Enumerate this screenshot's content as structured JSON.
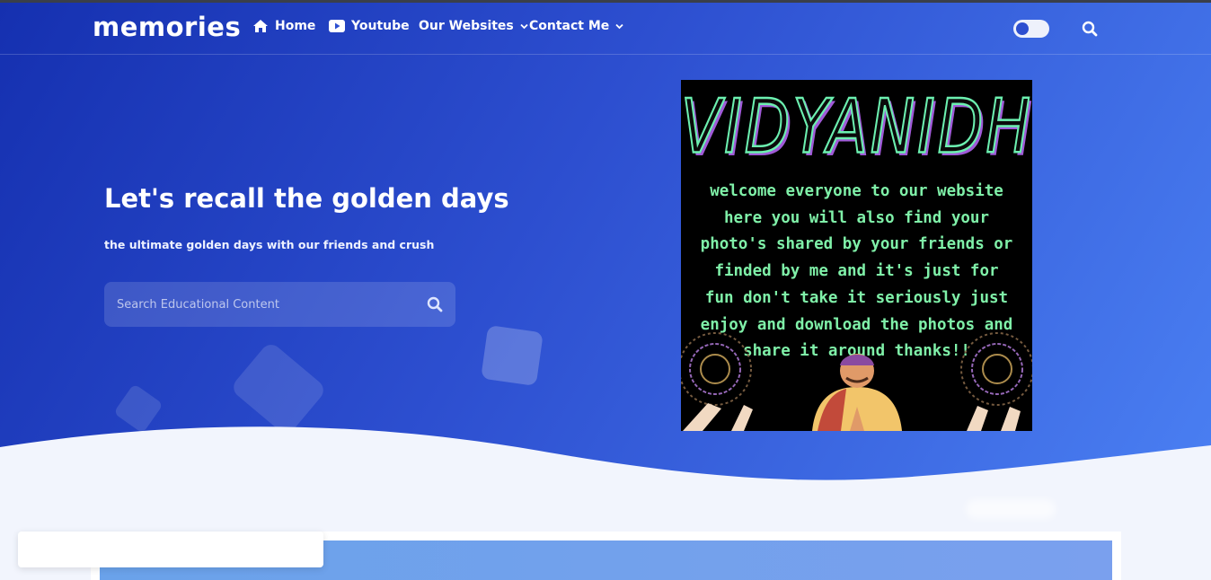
{
  "header": {
    "brand": "memories",
    "nav": [
      {
        "label": "Home",
        "icon": "home-icon"
      },
      {
        "label": "Youtube",
        "icon": "youtube-icon"
      },
      {
        "label": "Our Websites",
        "icon": "chevron-down-icon"
      },
      {
        "label": "Contact Me",
        "icon": "chevron-down-icon"
      }
    ],
    "theme_toggle_icon": "moon-icon",
    "search_icon": "search-icon"
  },
  "hero": {
    "title": "Let's recall the golden days",
    "subtitle": "the ultimate golden days with our friends and crush",
    "search_placeholder": "Search Educational Content"
  },
  "poster": {
    "title": "VIDYANIDHI",
    "lines": [
      "welcome everyone to our website",
      "here you will also find your",
      "photo's shared by your friends or",
      "finded by me and it's just for",
      "fun don't take it seriously just",
      "enjoy and download the photos and",
      "share it around thanks!!"
    ]
  },
  "colors": {
    "hero_start": "#1530b0",
    "hero_end": "#4a7ff2",
    "page_bg": "#f2f5fd",
    "poster_text": "#7ff0a8",
    "poster_title_stroke": "#6cf0b0",
    "poster_title_shadow": "#a05ad8"
  }
}
